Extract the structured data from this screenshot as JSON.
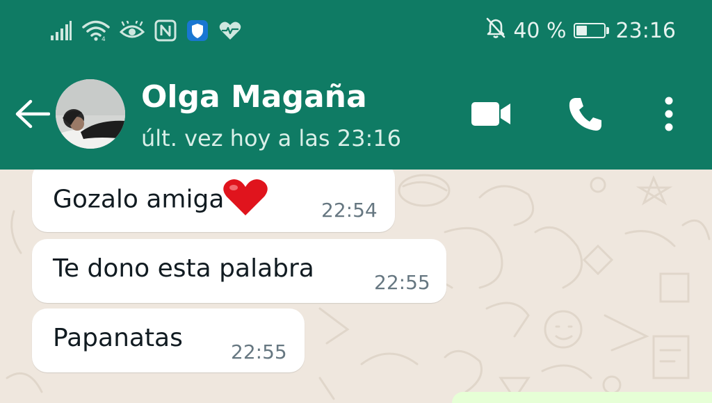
{
  "status_bar": {
    "battery_percent": "40 %",
    "battery_level": 0.4,
    "time": "23:16",
    "icons_left": [
      "signal-icon",
      "wifi-icon",
      "eye-icon",
      "nfc-icon",
      "shield-icon",
      "heart-monitor-icon"
    ],
    "icons_right": [
      "bell-off-icon",
      "battery-icon"
    ]
  },
  "header": {
    "contact_name": "Olga Magaña",
    "last_seen": "últ. vez hoy a las 23:16",
    "actions": [
      "back-arrow-icon",
      "video-call-icon",
      "phone-icon",
      "more-options-icon"
    ]
  },
  "messages": [
    {
      "text": "Gozalo amiga",
      "emoji": "heart-emoji",
      "time": "22:54"
    },
    {
      "text": "Te dono esta palabra",
      "time": "22:55"
    },
    {
      "text": "Papanatas",
      "time": "22:55"
    }
  ],
  "colors": {
    "header_green": "#0f7b64",
    "chat_background": "#efe7de",
    "incoming_bubble": "#ffffff",
    "outgoing_bubble": "#e6ffd6",
    "timestamp": "#667781"
  }
}
